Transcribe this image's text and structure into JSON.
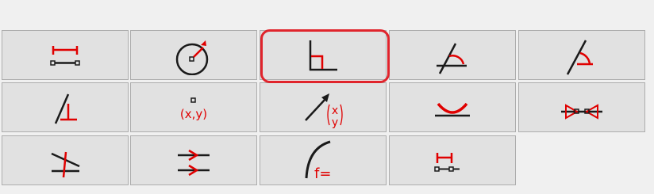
{
  "toolbar": {
    "buttons": [
      {
        "name": "horizontal-distance-constraint",
        "icon": "horizontal-dimension-icon"
      },
      {
        "name": "radius-constraint",
        "icon": "circle-radius-icon"
      },
      {
        "name": "perpendicular-constraint",
        "icon": "perpendicular-icon",
        "highlighted": true
      },
      {
        "name": "angle-constraint",
        "icon": "angle-arc-icon"
      },
      {
        "name": "angle-lines-constraint",
        "icon": "angle-lines-icon"
      },
      {
        "name": "point-on-line-constraint",
        "icon": "point-on-line-icon"
      },
      {
        "name": "point-coordinates-constraint",
        "icon": "point-xy-icon",
        "label": "(x,y)"
      },
      {
        "name": "vector-coordinates-constraint",
        "icon": "vector-xy-icon",
        "label_x": "x",
        "label_y": "y"
      },
      {
        "name": "tangent-constraint",
        "icon": "tangent-arc-icon"
      },
      {
        "name": "symmetric-constraint",
        "icon": "symmetric-icon"
      },
      {
        "name": "midpoint-constraint",
        "icon": "crossing-lines-icon"
      },
      {
        "name": "parallel-constraint",
        "icon": "parallel-icon"
      },
      {
        "name": "curve-function-constraint",
        "icon": "curve-function-icon",
        "label": "f="
      },
      {
        "name": "distance-between-points-constraint",
        "icon": "point-distance-icon"
      }
    ]
  },
  "colors": {
    "accent": "#e00000",
    "stroke": "#1a1a1a",
    "highlight": "#e0242c",
    "button_bg": "#e1e1e1",
    "button_border": "#adadad"
  }
}
